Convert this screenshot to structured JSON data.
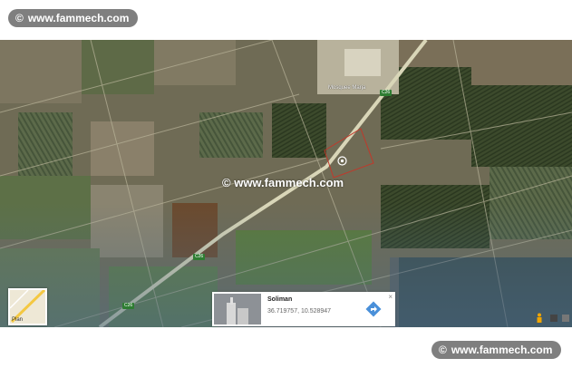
{
  "watermark": {
    "top": "www.fammech.com",
    "center": "www.fammech.com",
    "bottom": "www.fammech.com"
  },
  "map": {
    "poi_label": "Mosquee Marja",
    "road_labels": [
      "C26",
      "C26",
      "C26"
    ],
    "minimap_label": "Plan"
  },
  "info_card": {
    "title": "Soliman",
    "coordinates": "36.719757, 10.528947",
    "close": "×"
  },
  "colors": {
    "watermark_bg": "#7f7f7f",
    "road": "#d9d6b8",
    "parcel_outline": "#c0392b",
    "directions_blue": "#4a90d9"
  },
  "icons": [
    "copyright-icon",
    "location-pin-icon",
    "directions-icon",
    "pegman-icon",
    "close-icon"
  ]
}
